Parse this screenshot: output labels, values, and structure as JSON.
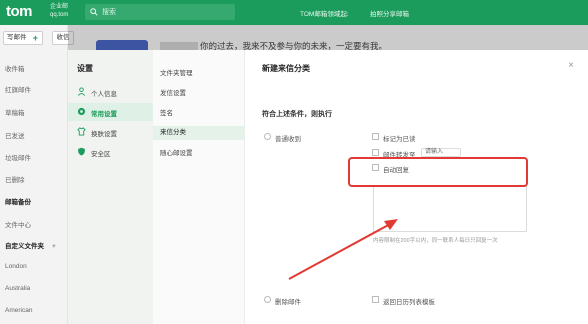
{
  "header": {
    "logo": "tom",
    "logo_sub_1": "企业邮",
    "logo_sub_2": "qq.tom",
    "search_placeholder": "搜索",
    "promo_1": "TOM邮箱领域起:",
    "promo_2": "拍照分享邮箱"
  },
  "sidebar": {
    "write_label": "写邮件",
    "receive_label": "收信",
    "items": [
      {
        "label": "收件箱",
        "bold": false
      },
      {
        "label": "红旗邮件",
        "bold": false
      },
      {
        "label": "草稿箱",
        "bold": false
      },
      {
        "label": "已发送",
        "bold": false
      },
      {
        "label": "垃圾邮件",
        "bold": false
      },
      {
        "label": "已删除",
        "bold": false
      },
      {
        "label": "邮箱备份",
        "bold": true
      },
      {
        "label": "文件中心",
        "bold": false
      },
      {
        "label": "自定义文件夹",
        "bold": true
      },
      {
        "label": "London",
        "bold": false
      },
      {
        "label": "Australia",
        "bold": false
      },
      {
        "label": "American",
        "bold": false
      }
    ]
  },
  "banner": {
    "text": "你的过去，我来不及参与你的未来，一定要有我。"
  },
  "settings": {
    "title": "设置",
    "nav": [
      {
        "label": "个人信息",
        "icon": "person-icon",
        "active": false
      },
      {
        "label": "常用设置",
        "icon": "settings-icon",
        "active": true
      },
      {
        "label": "换肤设置",
        "icon": "shirt-icon",
        "active": false
      },
      {
        "label": "安全区",
        "icon": "shield-icon",
        "active": false
      }
    ],
    "subnav": [
      {
        "label": "文件夹管理",
        "active": false
      },
      {
        "label": "发信设置",
        "active": false
      },
      {
        "label": "签名",
        "active": false
      },
      {
        "label": "来信分类",
        "active": true
      },
      {
        "label": "随心邮设置",
        "active": false
      }
    ],
    "panel": {
      "title": "新建来信分类",
      "condition_label": "符合上述条件，则执行",
      "option_normal": "普通收到",
      "opt_mark_read": "标记为已读",
      "opt_forward": "邮件转发至",
      "opt_forward_value": "请输入",
      "opt_auto_reply": "自动回复",
      "hint": "内容限制在200字以内，同一联系人每日只回复一次",
      "bottom_left": "删除邮件",
      "bottom_right": "返回日历列表模板"
    }
  },
  "colors": {
    "brand_green": "#1b9c5c",
    "highlight_red": "#e23a32"
  }
}
